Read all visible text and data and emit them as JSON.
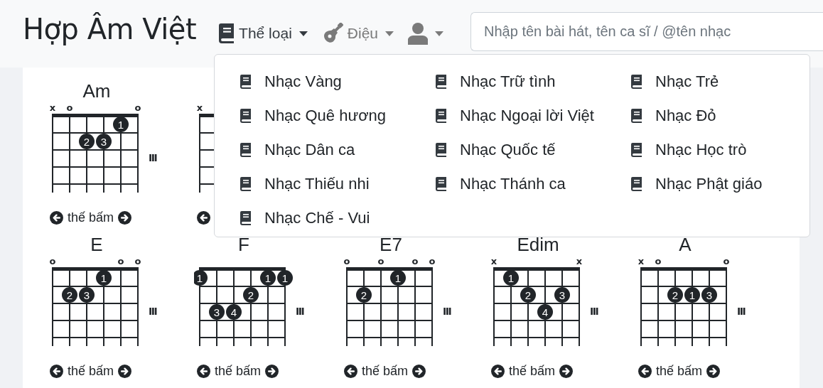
{
  "brand": "Hợp Âm Việt",
  "nav": [
    {
      "kind": "book",
      "label": "Thể loại",
      "expanded": true
    },
    {
      "kind": "guitar",
      "label": "Điệu",
      "expanded": false
    },
    {
      "kind": "user",
      "expanded": false
    }
  ],
  "search": {
    "placeholder": "Nhập tên bài hát, tên ca sĩ / @tên nhạc"
  },
  "chord_rows": [
    [
      {
        "name": "Am",
        "strings": [
          {
            "marker": "x"
          },
          {
            "marker": "o"
          },
          {
            "fret_2": "2"
          },
          {
            "fret_2": "3"
          },
          {
            "fret_1": "1"
          },
          {
            "marker": "o"
          }
        ],
        "position": "III",
        "nav_label": "thế bấm"
      },
      {
        "strings": [
          {
            "marker": "x"
          }
        ]
      }
    ],
    [
      {
        "name": "E",
        "strings": [
          {
            "marker": "o"
          },
          {
            "fret_2": "2"
          },
          {
            "fret_2": "3"
          },
          {
            "fret_1": "1"
          },
          {
            "marker": "o"
          },
          {
            "marker": "o"
          }
        ],
        "position": "III",
        "nav_label": "thế bấm"
      },
      {
        "name": "F",
        "strings": [
          {
            "fret_1": "1"
          },
          {
            "fret_3": "3"
          },
          {
            "fret_3": "4"
          },
          {
            "fret_2": "2"
          },
          {
            "fret_1": "1"
          },
          {
            "fret_1": "1"
          }
        ],
        "position": "III",
        "nav_label": "thế bấm"
      },
      {
        "name": "E7",
        "strings": [
          {
            "marker": "o"
          },
          {
            "fret_2": "2"
          },
          {
            "marker": "o"
          },
          {
            "fret_1": "1"
          },
          {
            "marker": "o"
          },
          {
            "marker": "o"
          }
        ],
        "position": "III",
        "nav_label": "thế bấm"
      },
      {
        "name": "Edim",
        "strings": [
          {
            "marker": "x"
          },
          {
            "fret_1": "1"
          },
          {
            "fret_2": "2"
          },
          {
            "fret_3": "4"
          },
          {
            "fret_2": "3"
          },
          {
            "marker": "x"
          }
        ],
        "position": "III",
        "nav_label": "thế bấm"
      },
      {
        "name": "A",
        "strings": [
          {
            "marker": "x"
          },
          {
            "marker": "o"
          },
          {
            "fret_2": "2"
          },
          {
            "fret_2": "1"
          },
          {
            "fret_2": "3"
          },
          {
            "marker": "o"
          }
        ],
        "position": "III",
        "nav_label": "thế bấm"
      }
    ]
  ],
  "genre_menu": [
    "Nhạc Vàng",
    "Nhạc Trữ tình",
    "Nhạc Trẻ",
    "Nhạc Quê hương",
    "Nhạc Ngoại lời Việt",
    "Nhạc Đỏ",
    "Nhạc Dân ca",
    "Nhạc Quốc tế",
    "Nhạc Học trò",
    "Nhạc Thiếu nhi",
    "Nhạc Thánh ca",
    "Nhạc Phật giáo",
    "Nhạc Chế - Vui"
  ]
}
